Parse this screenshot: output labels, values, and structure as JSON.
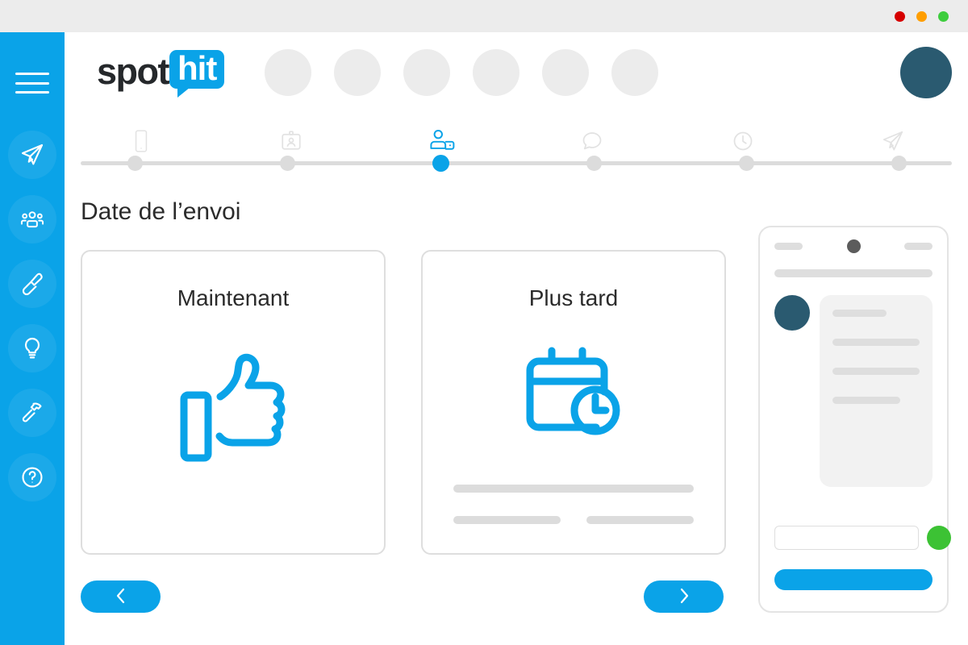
{
  "window": {
    "dots": [
      {
        "name": "close",
        "color": "#d60000"
      },
      {
        "name": "minimize",
        "color": "#ff9e00"
      },
      {
        "name": "maximize",
        "color": "#3ecd3e"
      }
    ]
  },
  "colors": {
    "brand_blue": "#0aa3e8",
    "avatar_teal": "#2a5a70",
    "skeleton_grey": "#dcdcdc",
    "border_grey": "#dedede",
    "green_badge": "#3cc234",
    "titlebar_grey": "#ececec"
  },
  "sidebar": {
    "menu_icon": "hamburger-menu-icon",
    "items": [
      {
        "icon": "paper-plane-icon",
        "label": "Campagnes"
      },
      {
        "icon": "contacts-group-icon",
        "label": "Contacts"
      },
      {
        "icon": "paintbrush-icon",
        "label": "Modeles"
      },
      {
        "icon": "lightbulb-icon",
        "label": "Idees"
      },
      {
        "icon": "hammer-tool-icon",
        "label": "Outils"
      },
      {
        "icon": "help-question-icon",
        "label": "Aide"
      }
    ]
  },
  "header": {
    "logo": {
      "text_primary": "spot",
      "text_secondary": "hit"
    },
    "placeholder_circle_count": 6,
    "avatar": {
      "icon": "user-avatar",
      "label": ""
    }
  },
  "stepper": {
    "active_index": 2,
    "steps": [
      {
        "icon": "mobile-phone-icon",
        "label": "",
        "active": false
      },
      {
        "icon": "id-badge-icon",
        "label": "",
        "active": false
      },
      {
        "icon": "user-tag-icon",
        "label": "",
        "active": true
      },
      {
        "icon": "message-bubble-icon",
        "label": "",
        "active": false
      },
      {
        "icon": "clock-icon",
        "label": "",
        "active": false
      },
      {
        "icon": "send-plane-icon",
        "label": "",
        "active": false
      }
    ]
  },
  "main": {
    "title": "Date de l’envoi",
    "cards": [
      {
        "title": "Maintenant",
        "icon": "thumbs-up-icon",
        "has_skeleton": false
      },
      {
        "title": "Plus tard",
        "icon": "calendar-clock-icon",
        "has_skeleton": true
      }
    ]
  },
  "navigation": {
    "previous": {
      "icon": "chevron-left-icon",
      "label": ""
    },
    "next": {
      "icon": "chevron-right-icon",
      "label": ""
    }
  },
  "preview": {
    "name": "phone-preview",
    "camera_dot": "camera-icon",
    "message_input_value": "",
    "send_badge": "send-green-badge",
    "cta_label": ""
  }
}
